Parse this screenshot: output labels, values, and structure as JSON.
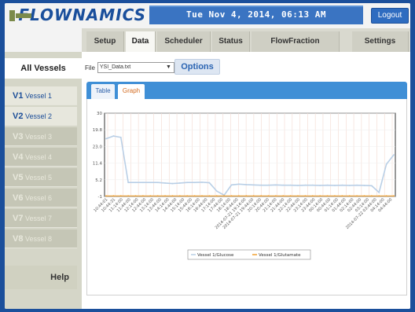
{
  "header": {
    "logo_text": "FLOWNAMICS",
    "datetime": "Tue Nov 4, 2014, 06:13 AM",
    "logout_label": "Logout"
  },
  "topnav": {
    "tabs": [
      {
        "label": "Setup"
      },
      {
        "label": "Data"
      },
      {
        "label": "Scheduler"
      },
      {
        "label": "Status"
      },
      {
        "label": "FlowFraction"
      },
      {
        "label": "Settings"
      }
    ],
    "active": "Data"
  },
  "sidebar": {
    "all_label": "All Vessels",
    "vessels": [
      {
        "id": "V1",
        "name": "Vessel 1",
        "enabled": true
      },
      {
        "id": "V2",
        "name": "Vessel 2",
        "enabled": true
      },
      {
        "id": "V3",
        "name": "Vessel 3",
        "enabled": false
      },
      {
        "id": "V4",
        "name": "Vessel 4",
        "enabled": false
      },
      {
        "id": "V5",
        "name": "Vessel 5",
        "enabled": false
      },
      {
        "id": "V6",
        "name": "Vessel 6",
        "enabled": false
      },
      {
        "id": "V7",
        "name": "Vessel 7",
        "enabled": false
      },
      {
        "id": "V8",
        "name": "Vessel 8",
        "enabled": false
      }
    ],
    "help_label": "Help"
  },
  "file": {
    "label": "File",
    "selected": "YSI_Data.txt"
  },
  "options_label": "Options",
  "subtabs": [
    {
      "label": "Table"
    },
    {
      "label": "Graph"
    }
  ],
  "subtab_active": "Graph",
  "chart_data": {
    "type": "line",
    "yticks": [
      "-1",
      "5.2",
      "11.4",
      "23.0",
      "19.8",
      "30"
    ],
    "ylim": [
      -1,
      30
    ],
    "x_labels": [
      "10:44:01",
      "10:44:31",
      "11:14:00",
      "11:44:00",
      "12:14:00",
      "12:44:00",
      "13:14:00",
      "13:44:00",
      "14:14:00",
      "14:44:00",
      "15:14:00",
      "15:44:00",
      "16:14:00",
      "16:44:00",
      "17:14:00",
      "17:44:00",
      "18:14:00",
      "18:44:00",
      "2014-07-21 19:14:00",
      "2014-07-21 19:44:00",
      "20:14:00",
      "20:44:00",
      "21:14:00",
      "21:44:00",
      "22:14:00",
      "22:44:00",
      "23:14:00",
      "23:44:00",
      "00:14:00",
      "00:44:00",
      "01:14:00",
      "01:44:00",
      "02:14:00",
      "02:44:00",
      "03:14:00",
      "2014-07-22 03:44:00",
      "04:14:00",
      "04:44:00"
    ],
    "series": [
      {
        "name": "Vessel 1/Glucose",
        "color": "#b9cfe6",
        "values": [
          20.5,
          21.5,
          21.0,
          4.2,
          4.2,
          4.2,
          4.2,
          4.2,
          4.0,
          3.8,
          4.0,
          4.2,
          4.2,
          4.3,
          4.1,
          1.0,
          -0.5,
          3.3,
          3.6,
          3.4,
          3.3,
          3.2,
          3.2,
          3.3,
          3.2,
          3.2,
          3.1,
          3.2,
          3.2,
          3.1,
          3.2,
          3.1,
          3.2,
          3.1,
          3.2,
          3.1,
          3.0,
          0.5,
          11.0,
          14.5
        ]
      },
      {
        "name": "Vessel 1/Glutamate",
        "color": "#f0a030",
        "values": [
          -0.8,
          -0.8,
          -0.8,
          -0.8,
          -0.8,
          -0.8,
          -0.8,
          -0.8,
          -0.8,
          -0.8,
          -0.8,
          -0.8,
          -0.8,
          -0.8,
          -0.8,
          -0.8,
          -0.8,
          -0.8,
          -0.8,
          -0.8,
          -0.8,
          -0.8,
          -0.8,
          -0.8,
          -0.8,
          -0.8,
          -0.8,
          -0.8,
          -0.8,
          -0.8,
          -0.8,
          -0.8,
          -0.8,
          -0.8,
          -0.8,
          -0.8,
          -0.8,
          -0.8,
          -0.8,
          -0.8
        ]
      }
    ],
    "grid": true,
    "legend": "bottom"
  }
}
